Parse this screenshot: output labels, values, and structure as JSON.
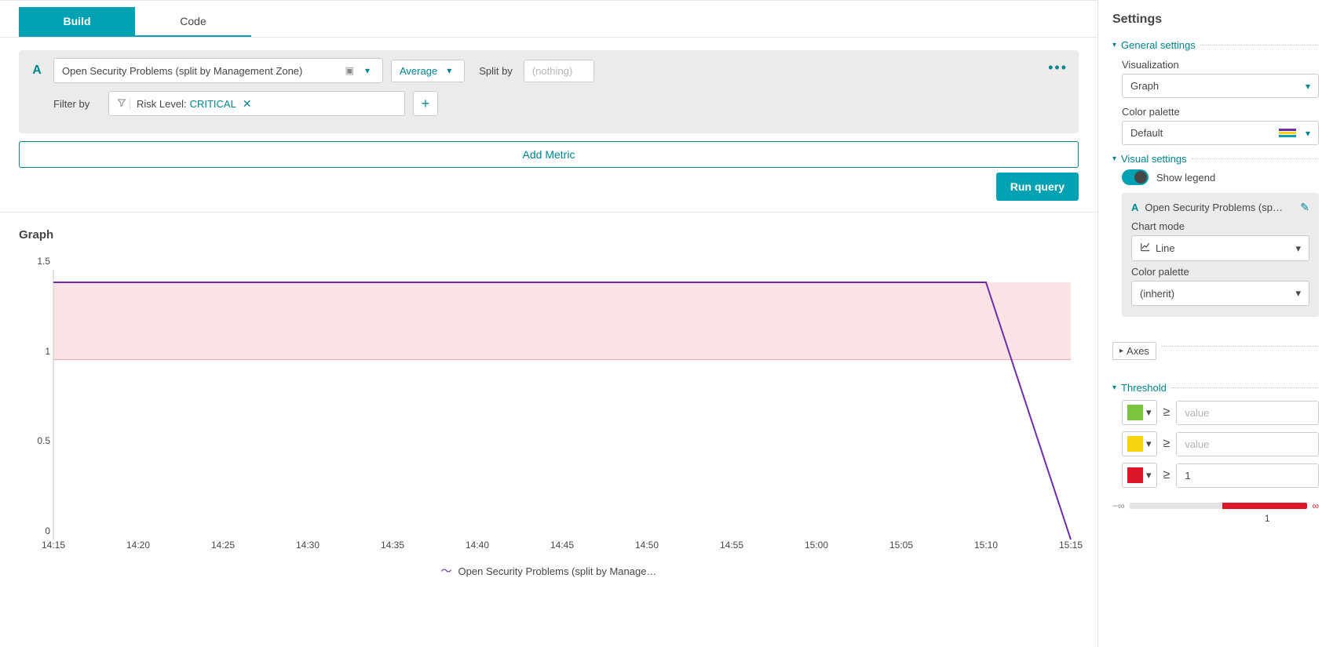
{
  "tabs": {
    "build": "Build",
    "code": "Code"
  },
  "query": {
    "badge": "A",
    "metric_name": "Open Security Problems (split by Management Zone)",
    "aggregation": "Average",
    "splitby_label": "Split by",
    "splitby_value": "(nothing)",
    "filter_label": "Filter by",
    "filter_key": "Risk Level:",
    "filter_value": " CRITICAL",
    "add_metric": "Add Metric",
    "run_query": "Run query"
  },
  "graph": {
    "title": "Graph",
    "legend": "Open Security Problems (split by Manage…"
  },
  "chart_data": {
    "type": "line",
    "title": "",
    "xlabel": "",
    "ylabel": "",
    "categories": [
      "14:15",
      "14:20",
      "14:25",
      "14:30",
      "14:35",
      "14:40",
      "14:45",
      "14:50",
      "14:55",
      "15:00",
      "15:05",
      "15:10",
      "15:15"
    ],
    "values": [
      1.43,
      1.43,
      1.43,
      1.43,
      1.43,
      1.43,
      1.43,
      1.43,
      1.43,
      1.43,
      1.43,
      1.43,
      0
    ],
    "ylim": [
      0,
      1.5
    ],
    "yticks": [
      0,
      0.5,
      1,
      1.5
    ],
    "threshold_fill_from": 1.0,
    "threshold_color": "#dc172a",
    "series_color": "#6f2da8"
  },
  "settings": {
    "title": "Settings",
    "general": {
      "head": "General settings",
      "vis_label": "Visualization",
      "vis_value": "Graph",
      "palette_label": "Color palette",
      "palette_value": "Default"
    },
    "visual": {
      "head": "Visual settings",
      "show_legend": "Show legend",
      "series_name_short": "Open Security Problems (sp…",
      "chart_mode_label": "Chart mode",
      "chart_mode_value": "Line",
      "series_palette_label": "Color palette",
      "series_palette_value": "(inherit)"
    },
    "axes": "Axes",
    "threshold": {
      "head": "Threshold",
      "placeholder": "value",
      "red_value": "1",
      "neg_inf": "−∞",
      "pos_inf": "∞",
      "tick": "1",
      "colors": {
        "green": "#7dc540",
        "yellow": "#f5d30f",
        "red": "#dc172a"
      }
    }
  }
}
